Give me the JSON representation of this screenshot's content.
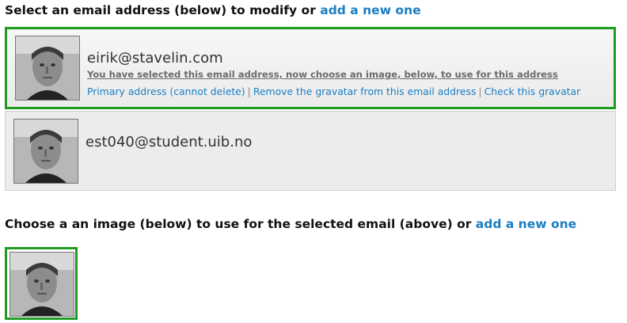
{
  "select_email": {
    "prefix": "Select an email address (below) to modify or",
    "add_link": "add a new one"
  },
  "emails": [
    {
      "address": "eirik@stavelin.com",
      "selected": true,
      "notice": "You have selected this email address, now choose an image, below, to use for this address",
      "primary": "Primary address (cannot delete)",
      "remove": "Remove the gravatar from this email address",
      "check": "Check this gravatar"
    },
    {
      "address": "est040@student.uib.no",
      "selected": false
    }
  ],
  "choose_image": {
    "prefix": "Choose a an image (below) to use for the selected email (above) or",
    "add_link": "add a new one"
  },
  "colors": {
    "accent_link": "#1b7ec2",
    "selected_border": "#1f9c22"
  }
}
